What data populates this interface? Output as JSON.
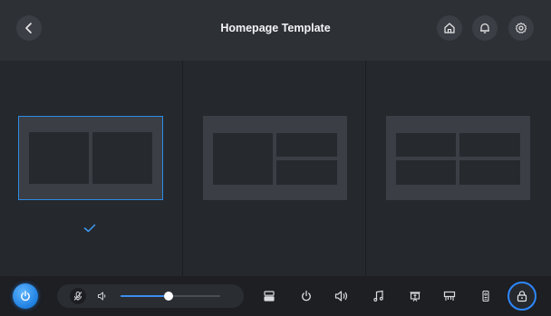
{
  "header": {
    "title": "Homepage Template",
    "back_icon": "chevron-left-icon",
    "home_icon": "home-icon",
    "bell_icon": "bell-icon",
    "settings_icon": "gear-icon"
  },
  "templates": [
    {
      "layout": "two-columns",
      "selected": true
    },
    {
      "layout": "one-left-two-right",
      "selected": false
    },
    {
      "layout": "two-by-two-grid",
      "selected": false
    }
  ],
  "footer": {
    "power_icon": "power-icon",
    "mute_icon": "mic-off-icon",
    "volume_icon": "speaker-icon",
    "volume_level": 0.48,
    "tools": [
      "server-icon",
      "power-icon",
      "speaker-icon",
      "music-icon",
      "projector-icon",
      "display-icon",
      "remote-icon"
    ],
    "lock_icon": "lock-icon"
  },
  "colors": {
    "accent": "#2d8be6",
    "header_bg": "#2d3035",
    "body_bg": "#25282d",
    "footer_bg": "#1d1f23"
  }
}
